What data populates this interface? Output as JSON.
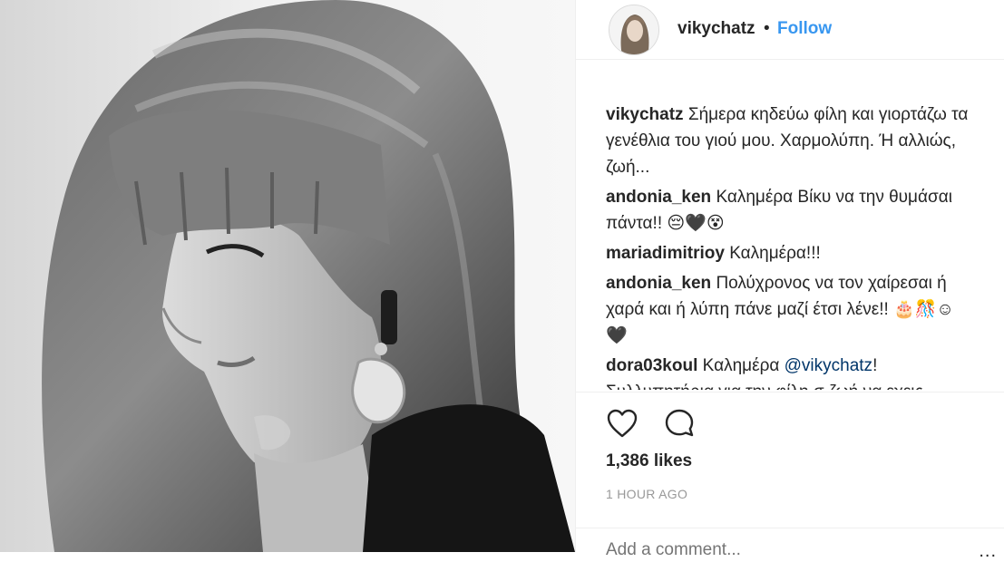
{
  "post": {
    "photo_alt": "vikychatz post photo",
    "header": {
      "username": "vikychatz",
      "separator": "•",
      "follow_label": "Follow"
    },
    "comments": [
      {
        "username": "vikychatz",
        "text": "Σήμερα κηδεύω φίλη και γιορτάζω τα γενέθλια του γιού μου. Χαρμολύπη. Ή αλλιώς, ζωή..."
      },
      {
        "username": "andonia_ken",
        "text": "Καλημέρα Βίκυ να την θυμάσαι πάντα!! 😔🖤😵"
      },
      {
        "username": "mariadimitrioy",
        "text": "Καλημέρα!!!"
      },
      {
        "username": "andonia_ken",
        "text": "Πολύχρονος να τον χαίρεσαι ή χαρά και ή λύπη πάνε μαζί έτσι λένε!! 🎂🎊☺🖤"
      },
      {
        "username": "dora03koul",
        "text_before": "Καλημέρα ",
        "mention": "@vikychatz",
        "text_after": "! Συλλυπητήρια για την φίλη σ ζωή να εχεις"
      }
    ],
    "actions": {
      "like_icon": "heart-icon",
      "comment_icon": "speech-bubble-icon"
    },
    "likes": "1,386 likes",
    "time": "1 HOUR AGO",
    "add_comment_placeholder": "Add a comment...",
    "more_options": "..."
  }
}
